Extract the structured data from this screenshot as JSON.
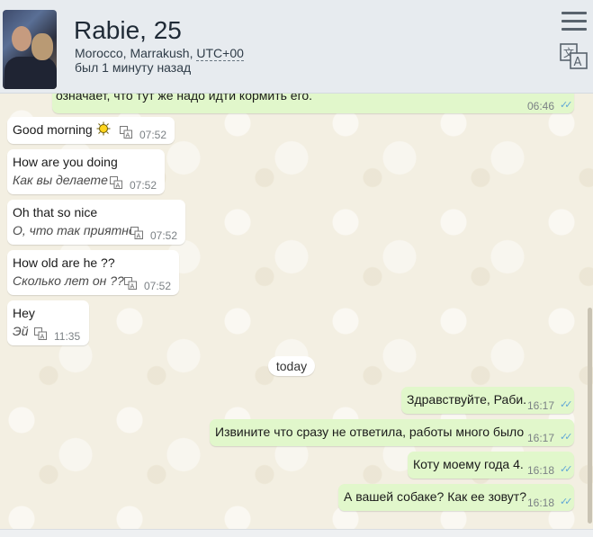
{
  "header": {
    "name": "Rabie, 25",
    "location": "Morocco, Marrakush, ",
    "timezone": "UTC+00",
    "last_seen": "был 1 минуту назад"
  },
  "icons": {
    "menu": "hamburger-menu-icon",
    "translate": "translate-icon",
    "read": "double-check-icon",
    "sun": "sun-emoji-icon"
  },
  "colors": {
    "header_bg": "#e7ebef",
    "incoming_bubble": "#ffffff",
    "outgoing_bubble": "#e1f7cb",
    "read_ticks": "#62a7d6",
    "chat_bg": "#f3efe2"
  },
  "messages": [
    {
      "dir": "out",
      "text": "означает, что тут же надо идти кормить его.",
      "time": "06:46",
      "read": true
    },
    {
      "dir": "in",
      "text": "Good morning",
      "time": "07:52",
      "emoji": "sun"
    },
    {
      "dir": "in",
      "text": "How are you doing",
      "translation": "Как вы делаете",
      "time": "07:52"
    },
    {
      "dir": "in",
      "text": "Oh that so nice",
      "translation": "О, что так приятно",
      "time": "07:52"
    },
    {
      "dir": "in",
      "text": "How old are he ??",
      "translation": "Сколько лет он ??",
      "time": "07:52"
    },
    {
      "dir": "in",
      "text": "Hey",
      "translation": "Эй",
      "time": "11:35"
    },
    {
      "dir": "out",
      "text": "Здравствуйте, Раби.",
      "time": "16:17",
      "read": true
    },
    {
      "dir": "out",
      "text": "Извините что сразу не ответила, работы много было",
      "time": "16:17",
      "read": true
    },
    {
      "dir": "out",
      "text": "Коту моему года 4.",
      "time": "16:18",
      "read": true
    },
    {
      "dir": "out",
      "text": "А вашей собаке? Как ее зовут?",
      "time": "16:18",
      "read": true
    }
  ],
  "day_separator": "today",
  "ticks_glyph": "✓✓"
}
